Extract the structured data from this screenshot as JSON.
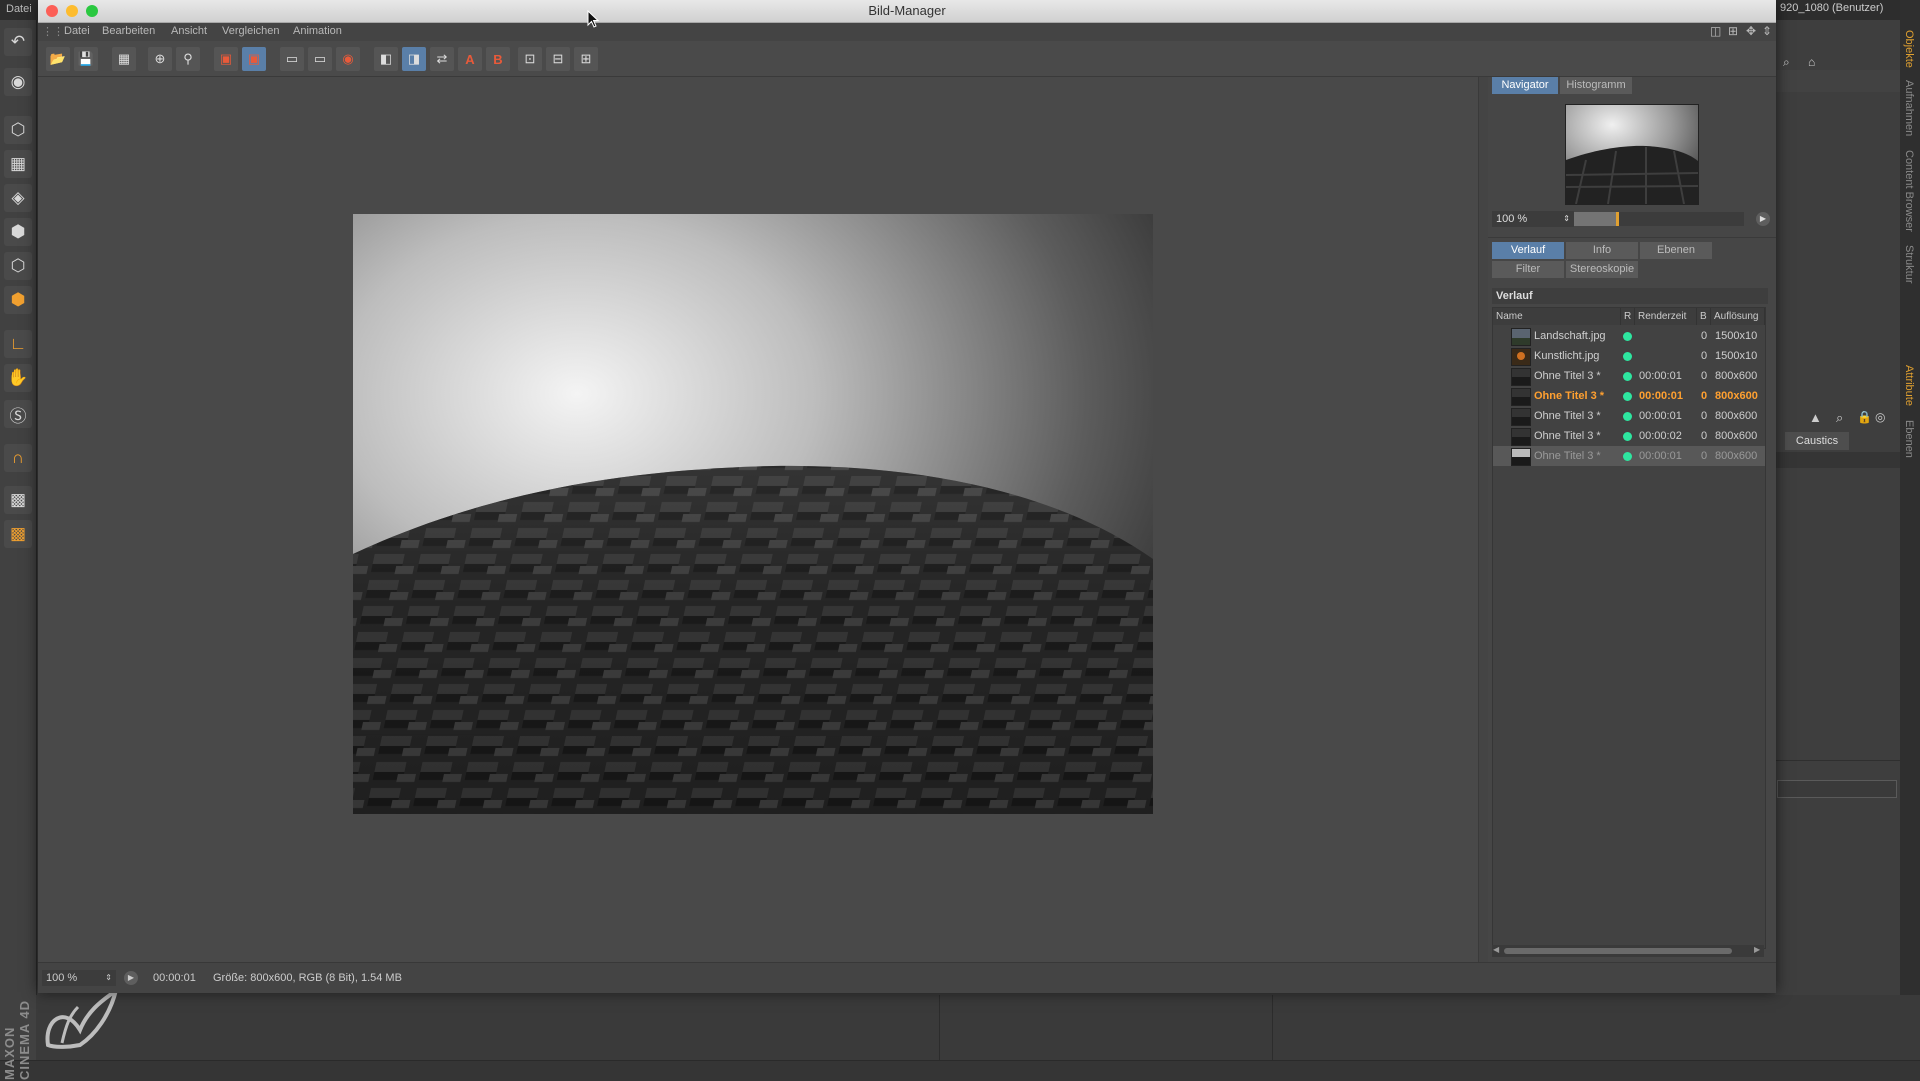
{
  "app": {
    "menu_first": "Datei",
    "resolution_label": "920_1080 (Benutzer)",
    "side_tabs": [
      "Objekte",
      "Aufnahmen",
      "Content Browser",
      "Struktur"
    ],
    "attr_tabs": [
      "Attribute",
      "Ebenen"
    ],
    "caustics_label": "Caustics",
    "brand_text": "MAXON CINEMA 4D"
  },
  "window": {
    "title": "Bild-Manager",
    "menu": [
      "Datei",
      "Bearbeiten",
      "Ansicht",
      "Vergleichen",
      "Animation"
    ]
  },
  "navigator": {
    "tabs": [
      "Navigator",
      "Histogramm"
    ],
    "zoom": "100 %",
    "zoom_fraction": 0.25
  },
  "panel_tabs": {
    "row1": [
      "Verlauf",
      "Info",
      "Ebenen"
    ],
    "row2": [
      "Filter",
      "Stereoskopie"
    ]
  },
  "history": {
    "title": "Verlauf",
    "columns": [
      "Name",
      "R",
      "Renderzeit",
      "B",
      "Auflösung"
    ],
    "rows": [
      {
        "name": "Landschaft.jpg",
        "time": "",
        "b": "0",
        "res": "1500x10"
      },
      {
        "name": "Kunstlicht.jpg",
        "time": "",
        "b": "0",
        "res": "1500x10"
      },
      {
        "name": "Ohne Titel 3 *",
        "time": "00:00:01",
        "b": "0",
        "res": "800x600"
      },
      {
        "name": "Ohne Titel 3 *",
        "time": "00:00:01",
        "b": "0",
        "res": "800x600"
      },
      {
        "name": "Ohne Titel 3 *",
        "time": "00:00:01",
        "b": "0",
        "res": "800x600"
      },
      {
        "name": "Ohne Titel 3 *",
        "time": "00:00:02",
        "b": "0",
        "res": "800x600"
      },
      {
        "name": "Ohne Titel 3 *",
        "time": "00:00:01",
        "b": "0",
        "res": "800x600"
      }
    ]
  },
  "status": {
    "zoom": "100 %",
    "time": "00:00:01",
    "info": "Größe: 800x600, RGB (8 Bit), 1.54 MB"
  },
  "colors": {
    "accent": "#5a7fa8",
    "highlight": "#ffa030",
    "status_dot": "#2ee6a0"
  }
}
